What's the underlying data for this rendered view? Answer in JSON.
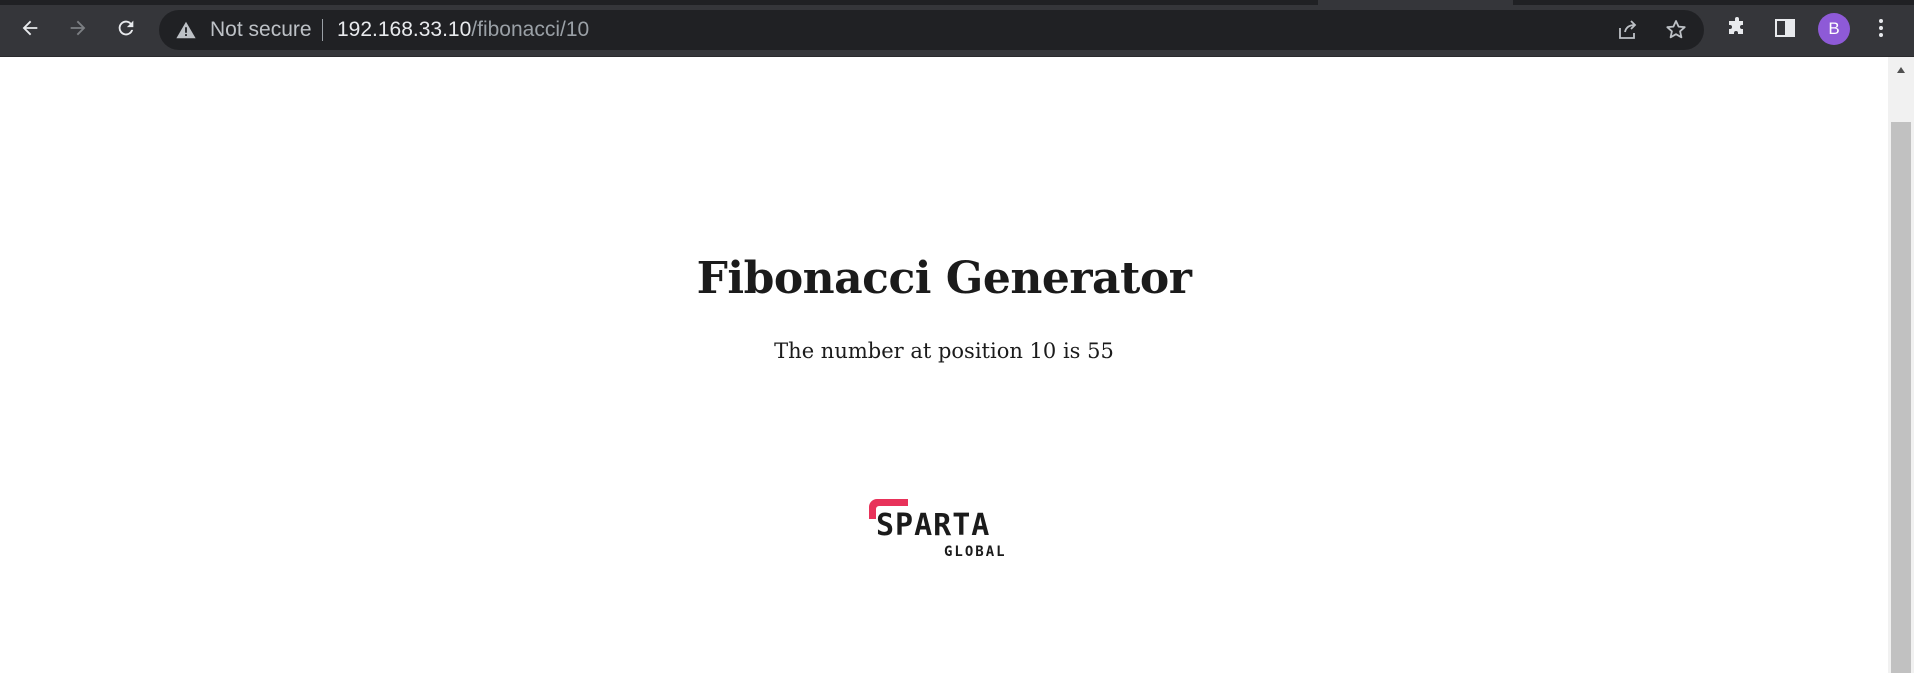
{
  "browser": {
    "omnibox": {
      "security_label": "Not secure",
      "url_host": "192.168.33.10",
      "url_path": "/fibonacci/10"
    },
    "profile_initial": "B",
    "icons": {
      "back": "arrow-left-icon",
      "forward": "arrow-right-icon",
      "reload": "reload-icon",
      "security": "warning-triangle-icon",
      "share": "share-icon",
      "bookmark": "star-icon",
      "extensions": "puzzle-icon",
      "side_panel": "side-panel-icon",
      "menu": "kebab-menu-icon"
    },
    "colors": {
      "toolbar": "#35363a",
      "omnibox": "#202124",
      "avatar": "#8e5ad7"
    }
  },
  "page": {
    "title": "Fibonacci Generator",
    "result_text": "The number at position 10 is 55",
    "logo": {
      "brand": "SPARTA",
      "sub": "GLOBAL",
      "accent_color": "#e8325a"
    }
  }
}
